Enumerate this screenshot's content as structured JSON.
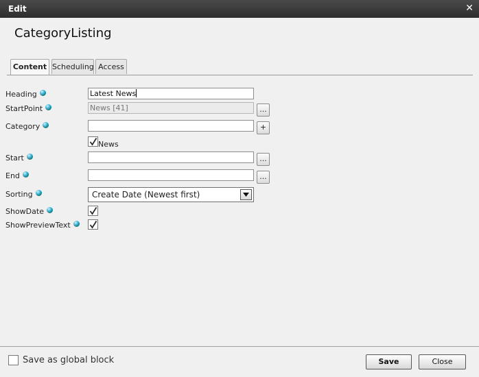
{
  "dialog": {
    "title": "Edit",
    "close_glyph": "✕"
  },
  "block_name": "CategoryListing",
  "tabs": [
    {
      "label": "Content",
      "active": true
    },
    {
      "label": "Scheduling",
      "active": false
    },
    {
      "label": "Access",
      "active": false
    }
  ],
  "form": {
    "heading": {
      "label": "Heading",
      "value": "Latest News"
    },
    "startpoint": {
      "label": "StartPoint",
      "value": "News [41]",
      "browse": "..."
    },
    "category": {
      "label": "Category",
      "value": "",
      "add": "+",
      "option_label": "News",
      "option_checked": true
    },
    "start": {
      "label": "Start",
      "value": "",
      "browse": "..."
    },
    "end": {
      "label": "End",
      "value": "",
      "browse": "..."
    },
    "sorting": {
      "label": "Sorting",
      "value": "Create Date (Newest first)"
    },
    "showdate": {
      "label": "ShowDate",
      "checked": true
    },
    "showpreviewtext": {
      "label": "ShowPreviewText",
      "checked": true
    }
  },
  "footer": {
    "global_block_label": "Save as global block",
    "global_block_checked": false,
    "save": "Save",
    "close": "Close"
  },
  "icons": {
    "info": "globe-icon",
    "check": "checkmark-icon",
    "dropdown": "triangle-down-icon"
  }
}
